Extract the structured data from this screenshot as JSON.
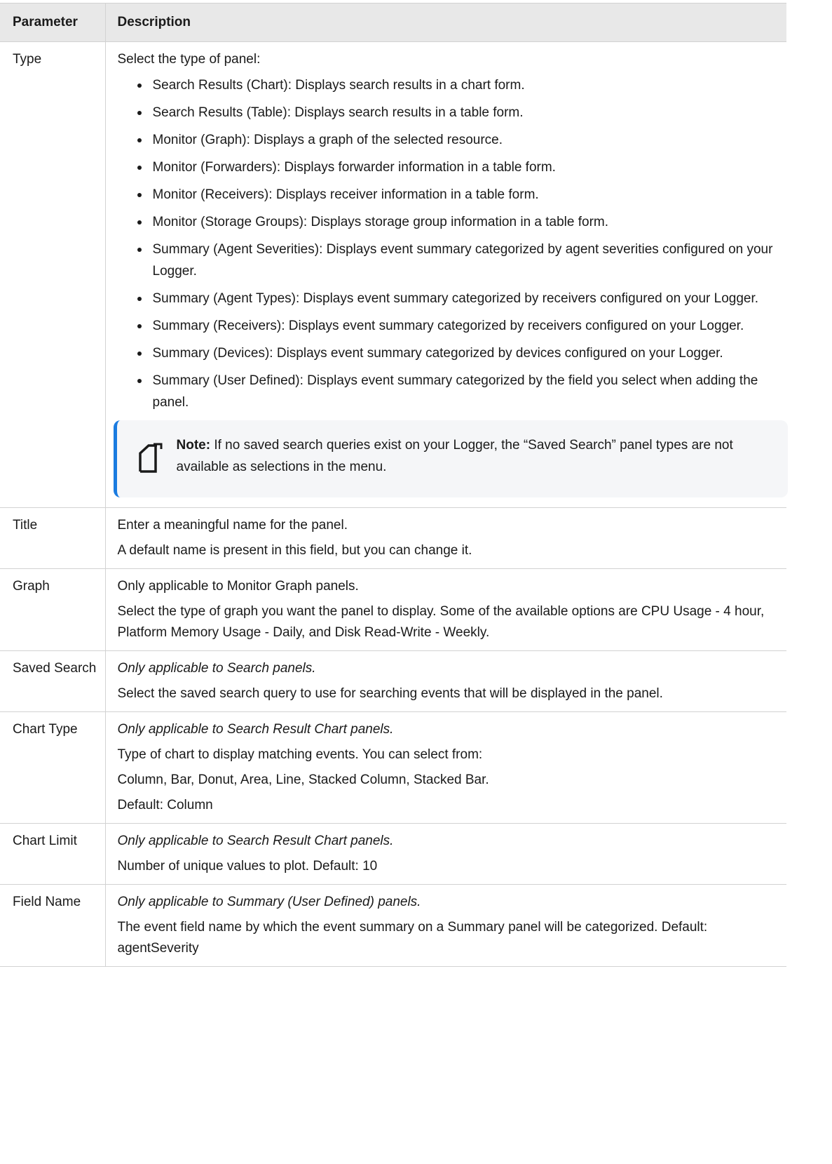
{
  "table": {
    "headers": [
      "Parameter",
      "Description"
    ],
    "type_row": {
      "param": "Type",
      "intro": "Select the type of panel:",
      "items": [
        "Search Results (Chart): Displays search results in a chart form.",
        "Search Results (Table): Displays search results in a table form.",
        "Monitor (Graph): Displays a graph of the selected resource.",
        "Monitor (Forwarders): Displays forwarder information in a table form.",
        "Monitor (Receivers): Displays receiver information in a table form.",
        "Monitor (Storage Groups): Displays storage group information in a table form.",
        "Summary (Agent Severities): Displays event summary categorized by agent severities configured on your Logger.",
        "Summary (Agent Types): Displays event summary categorized by receivers configured on your Logger.",
        "Summary (Receivers): Displays event summary categorized by receivers configured on your Logger.",
        "Summary (Devices): Displays event summary categorized by devices configured on your Logger.",
        "Summary (User Defined): Displays event summary categorized by the field you select when adding the panel."
      ],
      "note": {
        "label": "Note:",
        "text": " If no saved search queries exist on your Logger, the “Saved Search” panel types are not available as selections in the menu."
      }
    },
    "rows": [
      {
        "param": "Title",
        "lines": [
          {
            "text": "Enter a meaningful name for the panel.",
            "italic": false
          },
          {
            "text": "A default name is present in this field, but you can change it.",
            "italic": false
          }
        ]
      },
      {
        "param": "Graph",
        "lines": [
          {
            "text": "Only applicable to Monitor Graph panels.",
            "italic": false
          },
          {
            "text": "Select the type of graph you want the panel to display. Some of the available options are CPU Usage - 4 hour, Platform Memory Usage - Daily, and Disk Read-Write - Weekly.",
            "italic": false
          }
        ]
      },
      {
        "param": "Saved Search",
        "lines": [
          {
            "text": "Only applicable to Search panels.",
            "italic": true
          },
          {
            "text": "Select the saved search query to use for searching events that will be displayed in the panel.",
            "italic": false
          }
        ]
      },
      {
        "param": "Chart Type",
        "lines": [
          {
            "text": "Only applicable to Search Result Chart panels.",
            "italic": true
          },
          {
            "text": "Type of chart to display matching events. You can select from:",
            "italic": false
          },
          {
            "text": "Column, Bar, Donut, Area, Line, Stacked Column, Stacked Bar.",
            "italic": false
          },
          {
            "text": "Default: Column",
            "italic": false
          }
        ]
      },
      {
        "param": "Chart Limit",
        "lines": [
          {
            "text": "Only applicable to Search Result Chart panels.",
            "italic": true
          },
          {
            "text": "Number of unique values to plot. Default: 10",
            "italic": false
          }
        ]
      },
      {
        "param": "Field Name",
        "lines": [
          {
            "text": "Only applicable to Summary (User Defined) panels.",
            "italic": true
          },
          {
            "text": "The event field name by which the event summary on a Summary panel will be categorized. Default: agentSeverity",
            "italic": false
          }
        ]
      }
    ]
  },
  "icons": {
    "note": "note-icon"
  },
  "colors": {
    "header_bg": "#e8e8e8",
    "note_accent": "#1a7be0",
    "note_bg": "#f5f6f8"
  }
}
